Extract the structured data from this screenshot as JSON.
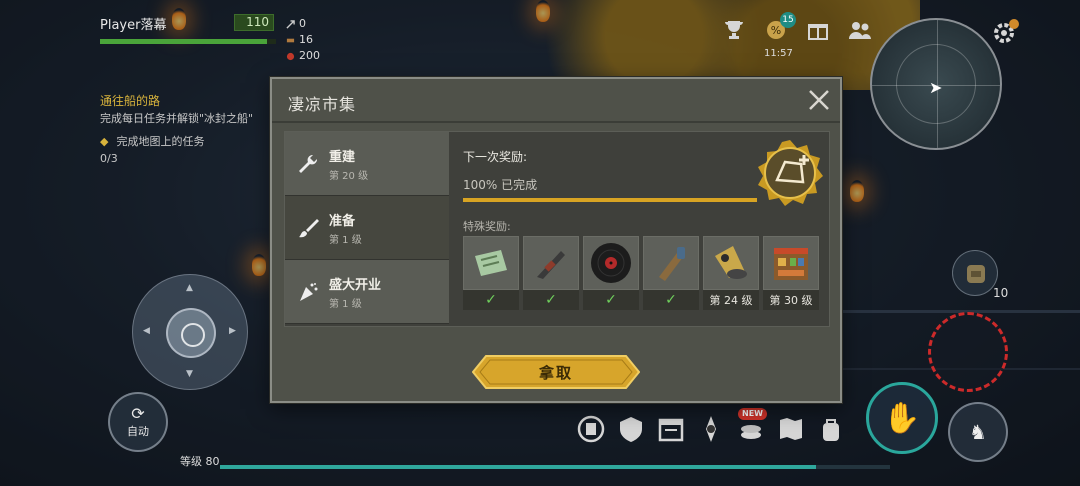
{
  "hud": {
    "player_name": "Player落幕",
    "player_level": "110",
    "hp_fraction": 0.95,
    "resources": [
      {
        "icon": "arrow-icon",
        "value": "0"
      },
      {
        "icon": "wood-icon",
        "value": "16"
      },
      {
        "icon": "meat-icon",
        "value": "200"
      }
    ]
  },
  "quest": {
    "title": "通往船的路",
    "description": "完成每日任务并解锁\"冰封之船\"",
    "objective": "完成地图上的任务",
    "progress": "0/3"
  },
  "top_bar": {
    "event_badge": "15",
    "clock": "11:57"
  },
  "controls": {
    "auto_label": "自动",
    "level_label": "等级 80",
    "xp_fraction": 0.89,
    "bag_count": "10",
    "new_badge": "NEW"
  },
  "modal": {
    "title": "凄凉市集",
    "tabs": [
      {
        "name": "重建",
        "level": "第 20 级",
        "icon": "wrench-icon"
      },
      {
        "name": "准备",
        "level": "第 1 级",
        "icon": "brush-icon"
      },
      {
        "name": "盛大开业",
        "level": "第 1 级",
        "icon": "party-popper-icon"
      }
    ],
    "next_reward_label": "下一次奖励:",
    "progress_text": "100% 已完成",
    "progress_fraction": 1.0,
    "special_label": "特殊奖励:",
    "items": [
      {
        "icon": "map-icon",
        "status": "✓"
      },
      {
        "icon": "gun-icon",
        "status": "✓"
      },
      {
        "icon": "vinyl-record-icon",
        "status": "✓"
      },
      {
        "icon": "guitar-case-icon",
        "status": "✓"
      },
      {
        "icon": "gramophone-icon",
        "status": "第 24 级"
      },
      {
        "icon": "market-stall-icon",
        "status": "第 30 级"
      }
    ],
    "claim_label": "拿取"
  },
  "colors": {
    "accent_gold": "#d8a423",
    "hp_green": "#4aa43a",
    "teal": "#2aa79c",
    "check_green": "#6fcf5c"
  }
}
